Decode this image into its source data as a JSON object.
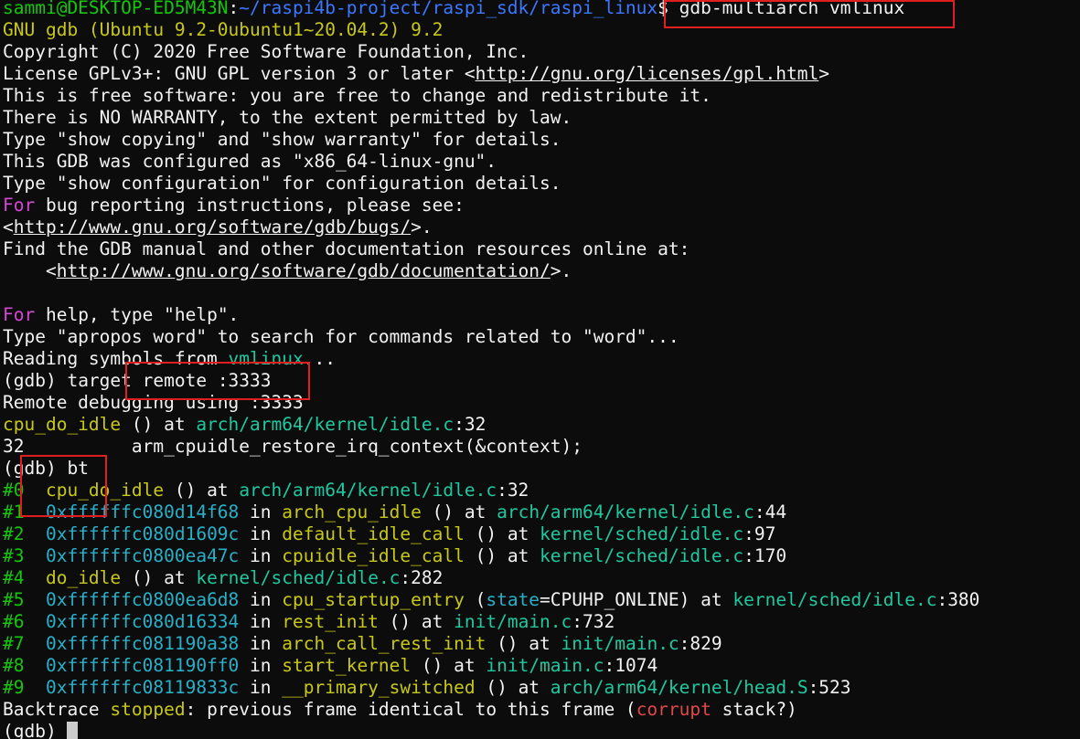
{
  "terminal": {
    "prompt": {
      "user_host": "sammi@DESKTOP-ED5M43N",
      "colon": ":",
      "path": "~/raspi4b-project/raspi_sdk/raspi_linux",
      "dollar": "$",
      "command": "gdb-multiarch vmlinux"
    },
    "banner": {
      "gnu_gdb": "GNU gdb (Ubuntu 9.2-0ubuntu1~20.04.2) 9.2",
      "copyright": "Copyright (C) 2020 Free Software Foundation, Inc.",
      "license_prefix": "License GPLv3+: GNU GPL version 3 or later <",
      "license_url": "http://gnu.org/licenses/gpl.html",
      "license_suffix": ">",
      "free_software": "This is free software: you are free to change and redistribute it.",
      "no_warranty": "There is NO WARRANTY, to the extent permitted by law.",
      "show_copying": "Type \"show copying\" and \"show warranty\" for details.",
      "configured_as": "This GDB was configured as \"x86_64-linux-gnu\".",
      "show_config": "Type \"show configuration\" for configuration details.",
      "for_word": "For",
      "bug_reporting": " bug reporting instructions, please see:",
      "bugs_open": "<",
      "bugs_url": "http://www.gnu.org/software/gdb/bugs/",
      "bugs_close": ">.",
      "find_manual": "Find the GDB manual and other documentation resources online at:",
      "doc_open": "    <",
      "doc_url": "http://www.gnu.org/software/gdb/documentation/",
      "doc_close": ">.",
      "help_for": "For",
      "help_rest": " help, type \"help\".",
      "apropos": "Type \"apropos word\" to search for commands related to \"word\"...",
      "reading_prefix": "Reading symbols from ",
      "reading_file": "vmlinux",
      "reading_suffix": "..."
    },
    "session": {
      "gdb_prompt": "(gdb) ",
      "cmd_target": "target remote :3333",
      "remote_debugging": "Remote debugging using :3333",
      "stop_func": "cpu_do_idle",
      "stop_mid": " () at ",
      "stop_file": "arch/arm64/kernel/idle.c",
      "stop_line": ":32",
      "src_line_no": "32",
      "src_line_gap": "          ",
      "src_code": "arm_cpuidle_restore_irq_context(&context);",
      "cmd_bt": "bt",
      "backtrace_stopped_prefix": "Backtrace ",
      "backtrace_stopped_word": "stopped",
      "backtrace_mid": ": previous frame identical to this frame (",
      "backtrace_corrupt": "corrupt",
      "backtrace_end": " stack?)",
      "final_prompt": "(gdb) "
    },
    "frames": [
      {
        "num": "#0",
        "addr": "",
        "func": "cpu_do_idle",
        "args": " ()",
        "file": "arch/arm64/kernel/idle.c",
        "line": ":32"
      },
      {
        "num": "#1",
        "addr": "0xffffffc080d14f68",
        "func": "arch_cpu_idle",
        "args": " ()",
        "file": "arch/arm64/kernel/idle.c",
        "line": ":44"
      },
      {
        "num": "#2",
        "addr": "0xffffffc080d1609c",
        "func": "default_idle_call",
        "args": " ()",
        "file": "kernel/sched/idle.c",
        "line": ":97"
      },
      {
        "num": "#3",
        "addr": "0xffffffc0800ea47c",
        "func": "cpuidle_idle_call",
        "args": " ()",
        "file": "kernel/sched/idle.c",
        "line": ":170"
      },
      {
        "num": "#4",
        "addr": "",
        "func": "do_idle",
        "args": " ()",
        "file": "kernel/sched/idle.c",
        "line": ":282"
      },
      {
        "num": "#5",
        "addr": "0xffffffc0800ea6d8",
        "func": "cpu_startup_entry",
        "args": " (",
        "arg_name": "state",
        "arg_eq": "=CPUHP_ONLINE)",
        "file": "kernel/sched/idle.c",
        "line": ":380"
      },
      {
        "num": "#6",
        "addr": "0xffffffc080d16334",
        "func": "rest_init",
        "args": " ()",
        "file": "init/main.c",
        "line": ":732"
      },
      {
        "num": "#7",
        "addr": "0xffffffc081190a38",
        "func": "arch_call_rest_init",
        "args": " ()",
        "file": "init/main.c",
        "line": ":829"
      },
      {
        "num": "#8",
        "addr": "0xffffffc081190ff0",
        "func": "start_kernel",
        "args": " ()",
        "file": "init/main.c",
        "line": ":1074"
      },
      {
        "num": "#9",
        "addr": "0xffffffc08119833c",
        "func": "__primary_switched",
        "args": " ()",
        "file": "arch/arm64/kernel/head.S",
        "line": ":523"
      }
    ],
    "words": {
      "in": " in ",
      "at": " at "
    },
    "colors": {
      "background": "#0c0c0c",
      "foreground": "#f2f2f2",
      "prompt_user": "#16c60c",
      "prompt_path": "#3b78ff",
      "yellow": "#c8c818",
      "magenta": "#d846d8",
      "cyan": "#28b0c8",
      "teal": "#20c8a0",
      "red": "#e04848",
      "highlight_box": "#e02020"
    }
  }
}
